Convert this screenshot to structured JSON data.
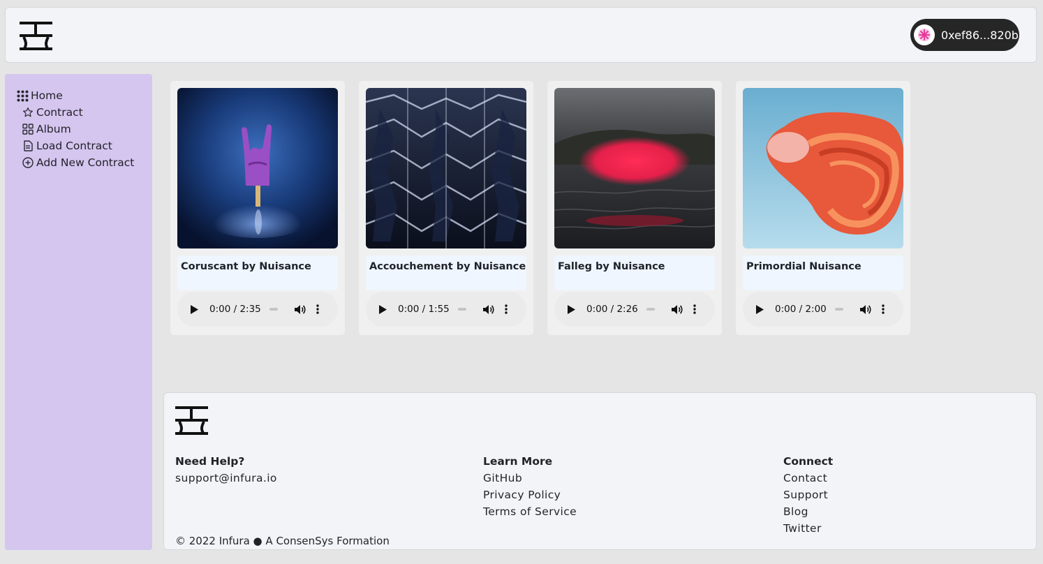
{
  "header": {
    "wallet_address": "0xef86...820b"
  },
  "sidebar": {
    "items": [
      {
        "label": "Home",
        "icon": "grid-dots-icon"
      },
      {
        "label": "Contract",
        "icon": "star-icon"
      },
      {
        "label": "Album",
        "icon": "grid-squares-icon"
      },
      {
        "label": "Load Contract",
        "icon": "document-icon"
      },
      {
        "label": "Add New Contract",
        "icon": "plus-circle-icon"
      }
    ]
  },
  "cards": [
    {
      "title": "Coruscant by Nuisance",
      "time": "0:00 / 2:35"
    },
    {
      "title": "Accouchement by Nuisance",
      "time": "0:00 / 1:55"
    },
    {
      "title": "Falleg by Nuisance",
      "time": "0:00 / 2:26"
    },
    {
      "title": "Primordial Nuisance",
      "time": "0:00 / 2:00"
    }
  ],
  "footer": {
    "help_heading": "Need Help?",
    "help_email": "support@infura.io",
    "learn_heading": "Learn More",
    "learn_links": [
      "GitHub",
      "Privacy Policy",
      "Terms of Service"
    ],
    "connect_heading": "Connect",
    "connect_links": [
      "Contact",
      "Support",
      "Blog",
      "Twitter"
    ],
    "copyright": "© 2022 Infura ● A ConsenSys Formation"
  },
  "colors": {
    "sidebar_bg": "#d4c6ef",
    "wallet_bg": "#262626",
    "title_box_bg": "#eff6ff"
  }
}
